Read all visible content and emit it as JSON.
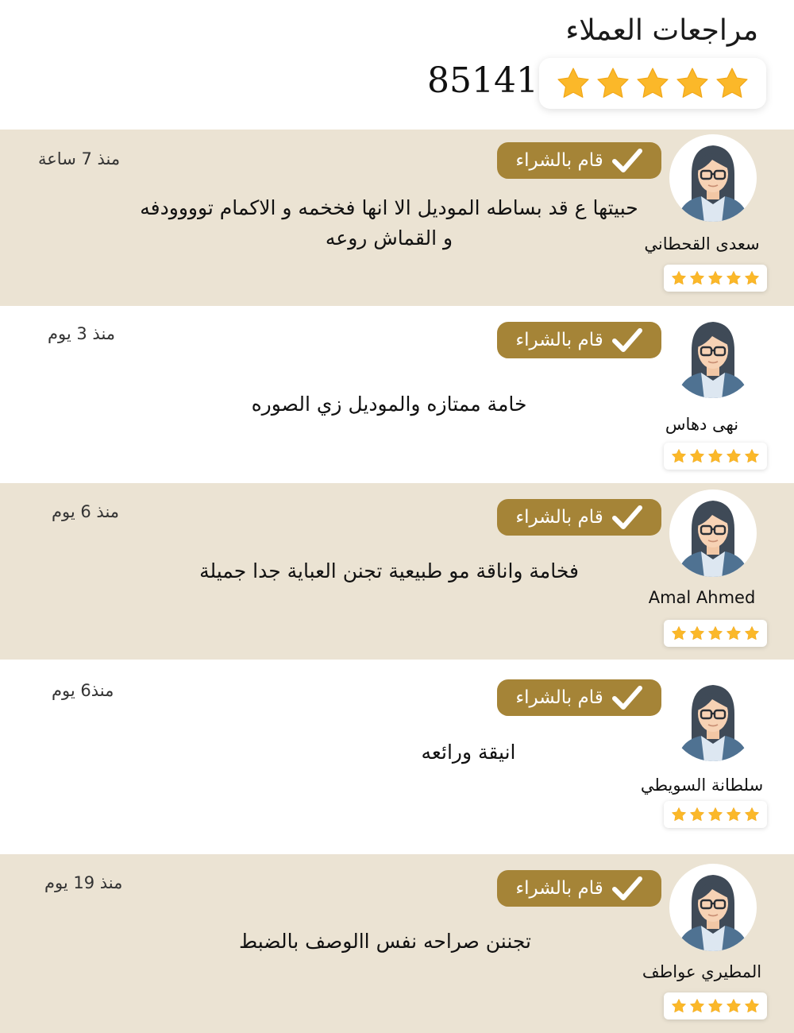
{
  "header": {
    "title": "مراجعات العملاء",
    "total_reviews": "85141",
    "overall_stars": 5,
    "star_color": "#fbb829"
  },
  "badge_color": "#a58437",
  "shade_color": "#ebe3d3",
  "reviews": [
    {
      "name": "سعدى القحطاني",
      "badge": "قام بالشراء",
      "time": "منذ 7 ساعة",
      "text": "حبيتها ع قد بساطه الموديل الا انها فخخمه و الاكمام توووودفه و القماش روعه",
      "stars": 5,
      "shaded": true
    },
    {
      "name": "نهى دهاس",
      "badge": "قام بالشراء",
      "time": "منذ 3 يوم",
      "text": "خامة ممتازه والموديل زي الصوره",
      "stars": 5,
      "shaded": false
    },
    {
      "name": "Amal Ahmed",
      "badge": "قام بالشراء",
      "time": "منذ 6 يوم",
      "text": "فخامة واناقة مو طبيعية تجنن العباية جدا جميلة",
      "stars": 5,
      "shaded": true
    },
    {
      "name": "سلطانة السويطي",
      "badge": "قام بالشراء",
      "time": "منذ6 يوم",
      "text": "انيقة ورائعه",
      "stars": 5,
      "shaded": false
    },
    {
      "name": "المطيري عواطف",
      "badge": "قام بالشراء",
      "time": "منذ 19 يوم",
      "text": "تجننن صراحه نفس االوصف بالضبط",
      "stars": 5,
      "shaded": true
    }
  ]
}
